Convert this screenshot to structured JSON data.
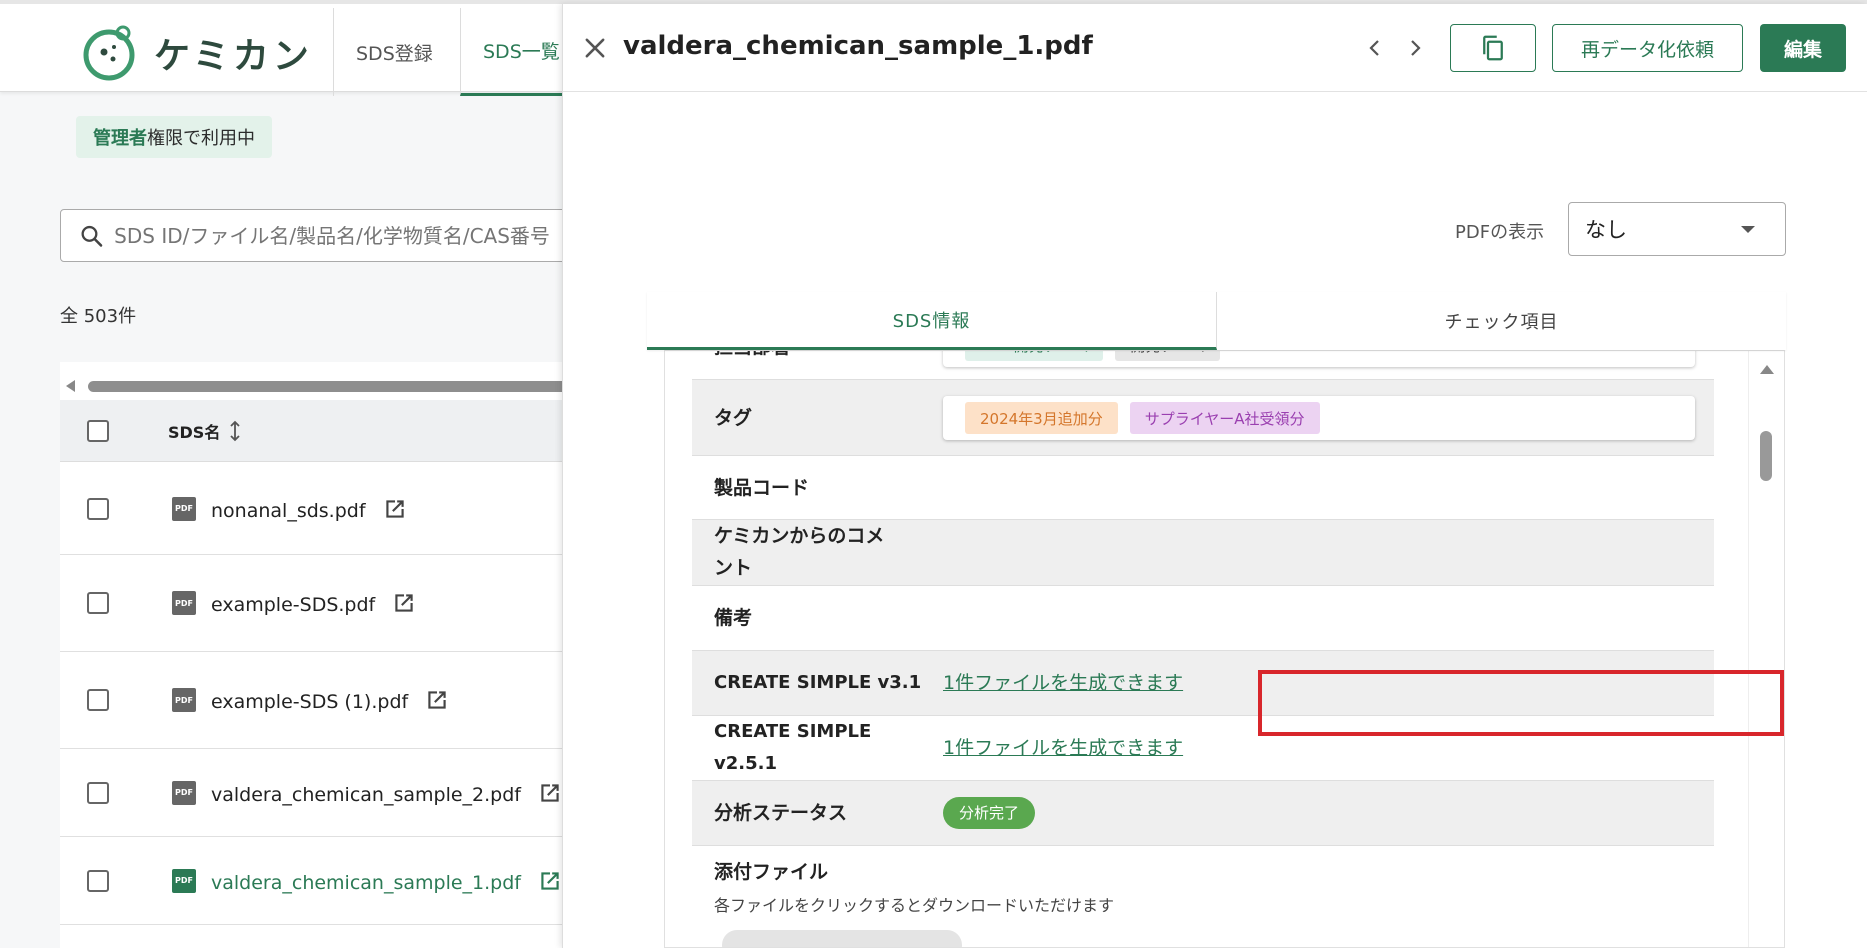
{
  "app": {
    "logo_text": "ケミカン",
    "nav": {
      "register": "SDS登録",
      "list": "SDS一覧"
    },
    "admin_badge": {
      "strong": "管理者",
      "rest": "権限で利用中"
    },
    "search": {
      "placeholder": "SDS ID/ファイル名/製品名/化学物質名/CAS番号"
    },
    "count_text": "全 503件",
    "table": {
      "header": "SDS名",
      "rows": [
        {
          "name": "nonanal_sds.pdf",
          "active": false
        },
        {
          "name": "example-SDS.pdf",
          "active": false
        },
        {
          "name": "example-SDS (1).pdf",
          "active": false
        },
        {
          "name": "valdera_chemican_sample_2.pdf",
          "active": false
        },
        {
          "name": "valdera_chemican_sample_1.pdf",
          "active": true
        }
      ]
    },
    "pdf_icon_text": "PDF"
  },
  "drawer": {
    "title": "valdera_chemican_sample_1.pdf",
    "buttons": {
      "redata": "再データ化依頼",
      "edit": "編集"
    },
    "pdf_display": {
      "label": "PDFの表示",
      "value": "なし"
    },
    "tabs": [
      {
        "label": "SDS情報"
      },
      {
        "label": "チェック項目"
      }
    ],
    "rows": {
      "dept": {
        "label": "担当部署",
        "chips": [
          "R&D開発チーム",
          "開発チーム"
        ]
      },
      "tag": {
        "label": "タグ",
        "chips": [
          "2024年3月追加分",
          "サプライヤーA社受領分"
        ]
      },
      "product_code": {
        "label": "製品コード"
      },
      "comment": {
        "label": "ケミカンからのコメント"
      },
      "remarks": {
        "label": "備考"
      },
      "cs31": {
        "label": "CREATE SIMPLE v3.1",
        "value": "1件ファイルを生成できます"
      },
      "cs251": {
        "label_line1": "CREATE SIMPLE",
        "label_line2": "v2.5.1",
        "value": "1件ファイルを生成できます"
      },
      "status": {
        "label": "分析ステータス",
        "value": "分析完了"
      },
      "attachment": {
        "label": "添付ファイル",
        "hint": "各ファイルをクリックするとダウンロードいただけます"
      }
    }
  },
  "colors": {
    "accent": "#2b7a55",
    "highlight": "#d8262b",
    "status_green": "#5aa84f"
  }
}
